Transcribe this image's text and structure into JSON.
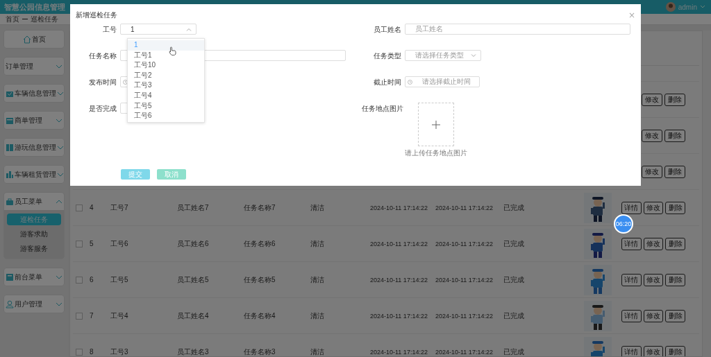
{
  "header": {
    "title": "智慧公园信息管理",
    "user": "admin"
  },
  "breadcrumb": [
    "首页",
    "巡检任务"
  ],
  "sidebar": {
    "items": [
      {
        "label": "首页",
        "kind": "link"
      },
      {
        "label": "订单管理",
        "kind": "group",
        "expanded": false
      },
      {
        "label": "车辆信息管理",
        "kind": "group",
        "expanded": false
      },
      {
        "label": "商单管理",
        "kind": "group",
        "expanded": false
      },
      {
        "label": "游玩信息管理",
        "kind": "group",
        "expanded": false
      },
      {
        "label": "车辆租赁管理",
        "kind": "group",
        "expanded": false
      },
      {
        "label": "员工菜单",
        "kind": "group",
        "expanded": true,
        "children": [
          {
            "label": "巡检任务",
            "selected": true
          },
          {
            "label": "游客求助",
            "selected": false
          },
          {
            "label": "游客服务",
            "selected": false
          }
        ]
      },
      {
        "label": "前台菜单",
        "kind": "group",
        "expanded": false
      },
      {
        "label": "用户管理",
        "kind": "group",
        "expanded": false
      }
    ]
  },
  "table": {
    "rows": [
      {
        "actions": [
          "修改",
          "删除"
        ]
      },
      {
        "actions": [
          "修改",
          "删除"
        ]
      },
      {
        "actions": [
          "修改",
          "删除"
        ]
      },
      {
        "checked": false,
        "index": "4",
        "job_no": "工号7",
        "name": "员工姓名7",
        "task": "任务名称7",
        "type": "清洁",
        "published": "2024-10-11 17:14:22",
        "deadline": "2024-10-11 17:14:22",
        "status": "已完成",
        "actions": [
          "详情",
          "修改",
          "删除"
        ]
      },
      {
        "checked": false,
        "index": "5",
        "job_no": "工号6",
        "name": "员工姓名6",
        "task": "任务名称6",
        "type": "清洁",
        "published": "2024-10-11 17:14:22",
        "deadline": "2024-10-11 17:14:22",
        "status": "已完成",
        "actions": [
          "详情",
          "修改",
          "删除"
        ]
      },
      {
        "checked": false,
        "index": "6",
        "job_no": "工号5",
        "name": "员工姓名5",
        "task": "任务名称5",
        "type": "清洁",
        "published": "2024-10-11 17:14:22",
        "deadline": "2024-10-11 17:14:22",
        "status": "已完成",
        "actions": [
          "详情",
          "修改",
          "删除"
        ]
      },
      {
        "checked": false,
        "index": "7",
        "job_no": "工号4",
        "name": "员工姓名4",
        "task": "任务名称4",
        "type": "清洁",
        "published": "2024-10-11 17:14:22",
        "deadline": "2024-10-11 17:14:22",
        "status": "已完成",
        "actions": [
          "详情",
          "修改",
          "删除"
        ]
      },
      {
        "checked": false,
        "index": "8",
        "job_no": "工号3",
        "name": "员工姓名3",
        "task": "任务名称3",
        "type": "清洁",
        "published": "2024-10-11 17:14:22",
        "deadline": "2024-10-11 17:14:22",
        "status": "已完成",
        "actions": [
          "详情",
          "修改",
          "删除"
        ]
      }
    ]
  },
  "dialog": {
    "title": "新增巡检任务",
    "close": "×",
    "fields": [
      {
        "label": "工号",
        "kind": "select",
        "value": "1",
        "expanded": true,
        "options": [
          {
            "label": "1",
            "selected": true
          },
          {
            "label": "工号1",
            "selected": false
          },
          {
            "label": "工号10",
            "selected": false
          },
          {
            "label": "工号2",
            "selected": false
          },
          {
            "label": "工号3",
            "selected": false
          },
          {
            "label": "工号4",
            "selected": false
          },
          {
            "label": "工号5",
            "selected": false
          },
          {
            "label": "工号6",
            "selected": false
          }
        ]
      },
      {
        "label": "员工姓名",
        "kind": "text",
        "placeholder": "员工姓名"
      },
      {
        "label": "任务名称",
        "kind": "text"
      },
      {
        "label": "任务类型",
        "kind": "select",
        "placeholder": "请选择任务类型",
        "expanded": false
      },
      {
        "label": "发布时间",
        "kind": "date"
      },
      {
        "label": "截止时间",
        "kind": "date",
        "placeholder": "请选择截止时间"
      },
      {
        "label": "是否完成",
        "kind": "plain"
      },
      {
        "label": "任务地点图片",
        "kind": "upload",
        "hint": "请上传任务地点图片"
      }
    ],
    "buttons": [
      {
        "label": "提交",
        "kind": "primary"
      },
      {
        "label": "取消",
        "kind": "secondary"
      }
    ]
  },
  "timer": "06:20"
}
